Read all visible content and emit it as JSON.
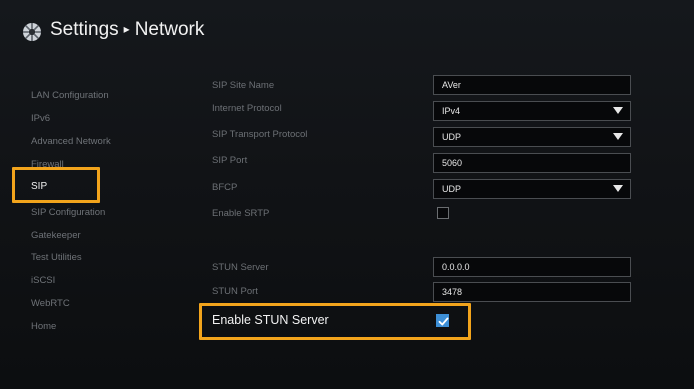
{
  "header": {
    "title": "Settings",
    "separator": "▸",
    "section": "Network",
    "logo_icon": "globe-settings-icon"
  },
  "sidebar": {
    "items": [
      {
        "label": "LAN Configuration",
        "active": false
      },
      {
        "label": "IPv6",
        "active": false
      },
      {
        "label": "Advanced Network",
        "active": false
      },
      {
        "label": "Firewall",
        "active": false
      },
      {
        "label": "SIP",
        "active": true
      },
      {
        "label": "SIP Configuration",
        "active": false
      },
      {
        "label": "Gatekeeper",
        "active": false
      },
      {
        "label": "Test Utilities",
        "active": false
      },
      {
        "label": "iSCSI",
        "active": false
      },
      {
        "label": "WebRTC",
        "active": false
      },
      {
        "label": "Home",
        "active": false
      }
    ]
  },
  "form": {
    "sip_site_name": {
      "label": "SIP Site Name",
      "value": "AVer"
    },
    "internet_protocol": {
      "label": "Internet Protocol",
      "value": "IPv4"
    },
    "sip_transport_protocol": {
      "label": "SIP Transport Protocol",
      "value": "UDP"
    },
    "sip_port": {
      "label": "SIP Port",
      "value": "5060"
    },
    "bfcp": {
      "label": "BFCP",
      "value": "UDP"
    },
    "enable_srtp": {
      "label": "Enable SRTP",
      "checked": false
    },
    "stun_server": {
      "label": "STUN Server",
      "value": "0.0.0.0"
    },
    "stun_port": {
      "label": "STUN Port",
      "value": "3478"
    },
    "enable_stun_server": {
      "label": "Enable STUN Server",
      "checked": true
    }
  },
  "colors": {
    "highlight": "#f2a41c",
    "checkbox_checked": "#3d8fd6",
    "background": "#121417"
  }
}
